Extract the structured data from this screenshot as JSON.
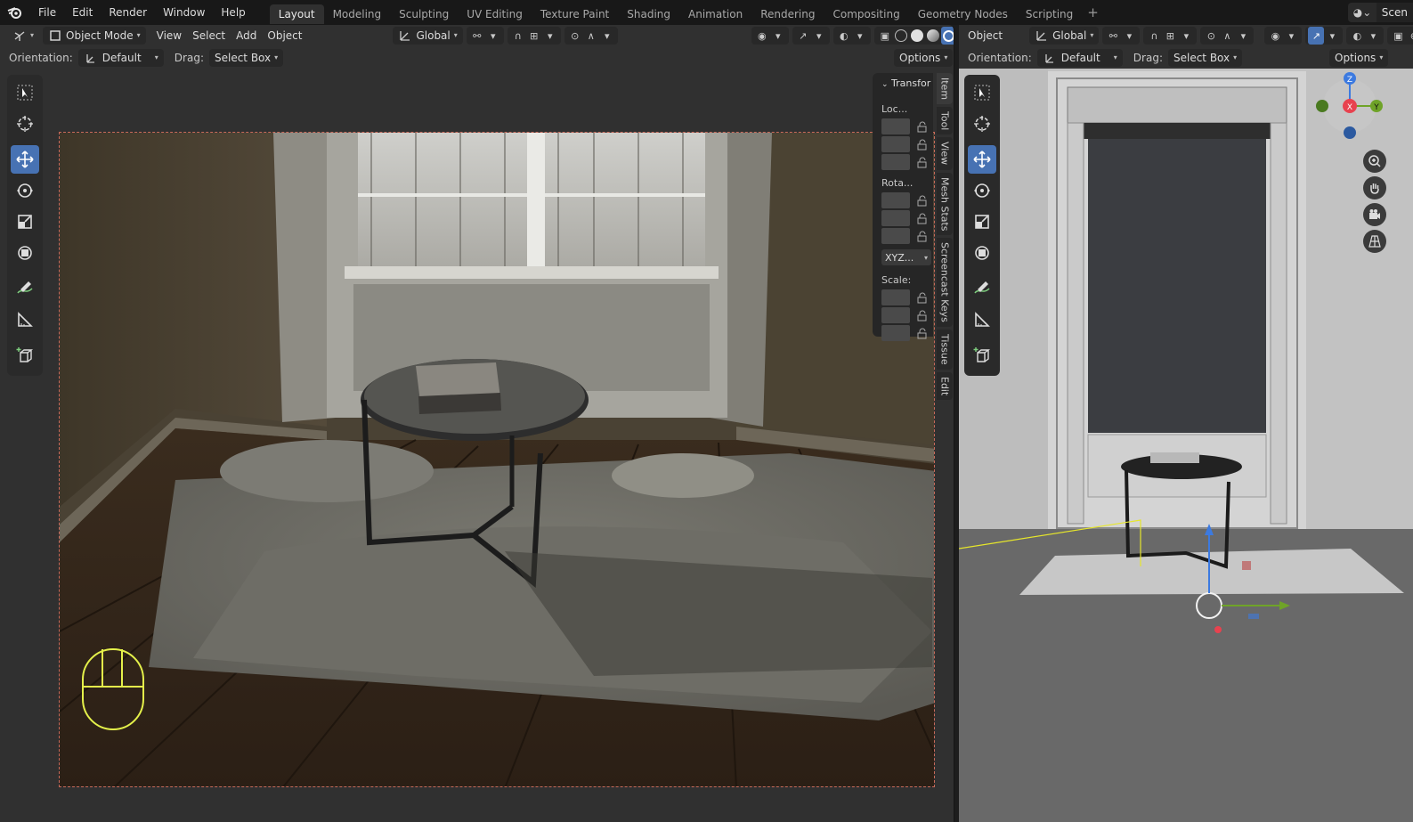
{
  "topbar": {
    "menus": [
      "File",
      "Edit",
      "Render",
      "Window",
      "Help"
    ],
    "workspaces": [
      {
        "label": "Layout",
        "active": true
      },
      {
        "label": "Modeling"
      },
      {
        "label": "Sculpting"
      },
      {
        "label": "UV Editing"
      },
      {
        "label": "Texture Paint"
      },
      {
        "label": "Shading"
      },
      {
        "label": "Animation"
      },
      {
        "label": "Rendering"
      },
      {
        "label": "Compositing"
      },
      {
        "label": "Geometry Nodes"
      },
      {
        "label": "Scripting"
      }
    ],
    "add_workspace": "+",
    "scene_label": "Scen"
  },
  "left": {
    "mode": "Object Mode",
    "menus": [
      "View",
      "Select",
      "Add",
      "Object"
    ],
    "transform_orientation": "Global",
    "orientation_label": "Orientation:",
    "orientation_value": "Default",
    "drag_label": "Drag:",
    "drag_value": "Select Box",
    "options": "Options",
    "npanel": {
      "header": "Transfor",
      "location": "Loc...",
      "rotation": "Rota...",
      "rotation_mode": "XYZ...",
      "scale": "Scale:"
    },
    "tabs": [
      "Item",
      "Tool",
      "View",
      "Mesh Stats",
      "Screencast Keys",
      "Tissue",
      "Edit"
    ]
  },
  "right": {
    "menu": "Object",
    "transform_orientation": "Global",
    "orientation_label": "Orientation:",
    "orientation_value": "Default",
    "drag_label": "Drag:",
    "drag_value": "Select Box",
    "options": "Options",
    "gizmo": {
      "z": "Z",
      "x": "X",
      "y": "Y"
    }
  },
  "colors": {
    "accent": "#4772b3",
    "gizmo_x": "#e8424f",
    "gizmo_y": "#6fa328",
    "gizmo_z": "#3c7ae0",
    "render_border": "#c86a5a",
    "mouse_overlay": "#e4f04a"
  }
}
